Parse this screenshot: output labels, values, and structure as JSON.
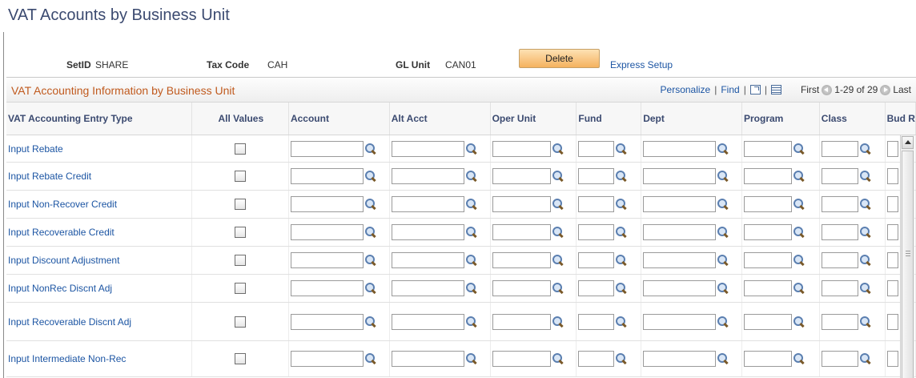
{
  "page_title": "VAT Accounts by Business Unit",
  "keys": {
    "setid_label": "SetID",
    "setid_value": "SHARE",
    "taxcode_label": "Tax Code",
    "taxcode_value": "CAH",
    "glunit_label": "GL Unit",
    "glunit_value": "CAN01"
  },
  "actions": {
    "delete_label": "Delete",
    "express_setup_label": "Express Setup"
  },
  "grid": {
    "title": "VAT Accounting Information by Business Unit",
    "personalize_label": "Personalize",
    "find_label": "Find",
    "first_label": "First",
    "range_label": "1-29 of 29",
    "last_label": "Last",
    "columns": [
      "VAT Accounting Entry Type",
      "All Values",
      "Account",
      "Alt Acct",
      "Oper Unit",
      "Fund",
      "Dept",
      "Program",
      "Class",
      "Bud R"
    ],
    "rows": [
      {
        "entry_type": "Input Rebate",
        "all_values": false
      },
      {
        "entry_type": "Input Rebate Credit",
        "all_values": false
      },
      {
        "entry_type": "Input Non-Recover Credit",
        "all_values": false
      },
      {
        "entry_type": "Input Recoverable Credit",
        "all_values": false
      },
      {
        "entry_type": "Input Discount Adjustment",
        "all_values": false
      },
      {
        "entry_type": "Input NonRec Discnt Adj",
        "all_values": false
      },
      {
        "entry_type": "Input Recoverable Discnt Adj",
        "all_values": false
      },
      {
        "entry_type": "Input Intermediate Non-Rec",
        "all_values": false
      }
    ]
  },
  "icons": {
    "lookup": "magnifier-lookup-icon",
    "zoom": "zoom-grid-icon",
    "download": "download-grid-icon",
    "prev": "previous-circle-icon",
    "next": "next-circle-icon"
  },
  "colors": {
    "title": "#3b4a70",
    "link": "#1c55a3",
    "grid_title": "#c05a1e",
    "delete_button": "#f5b25f"
  }
}
